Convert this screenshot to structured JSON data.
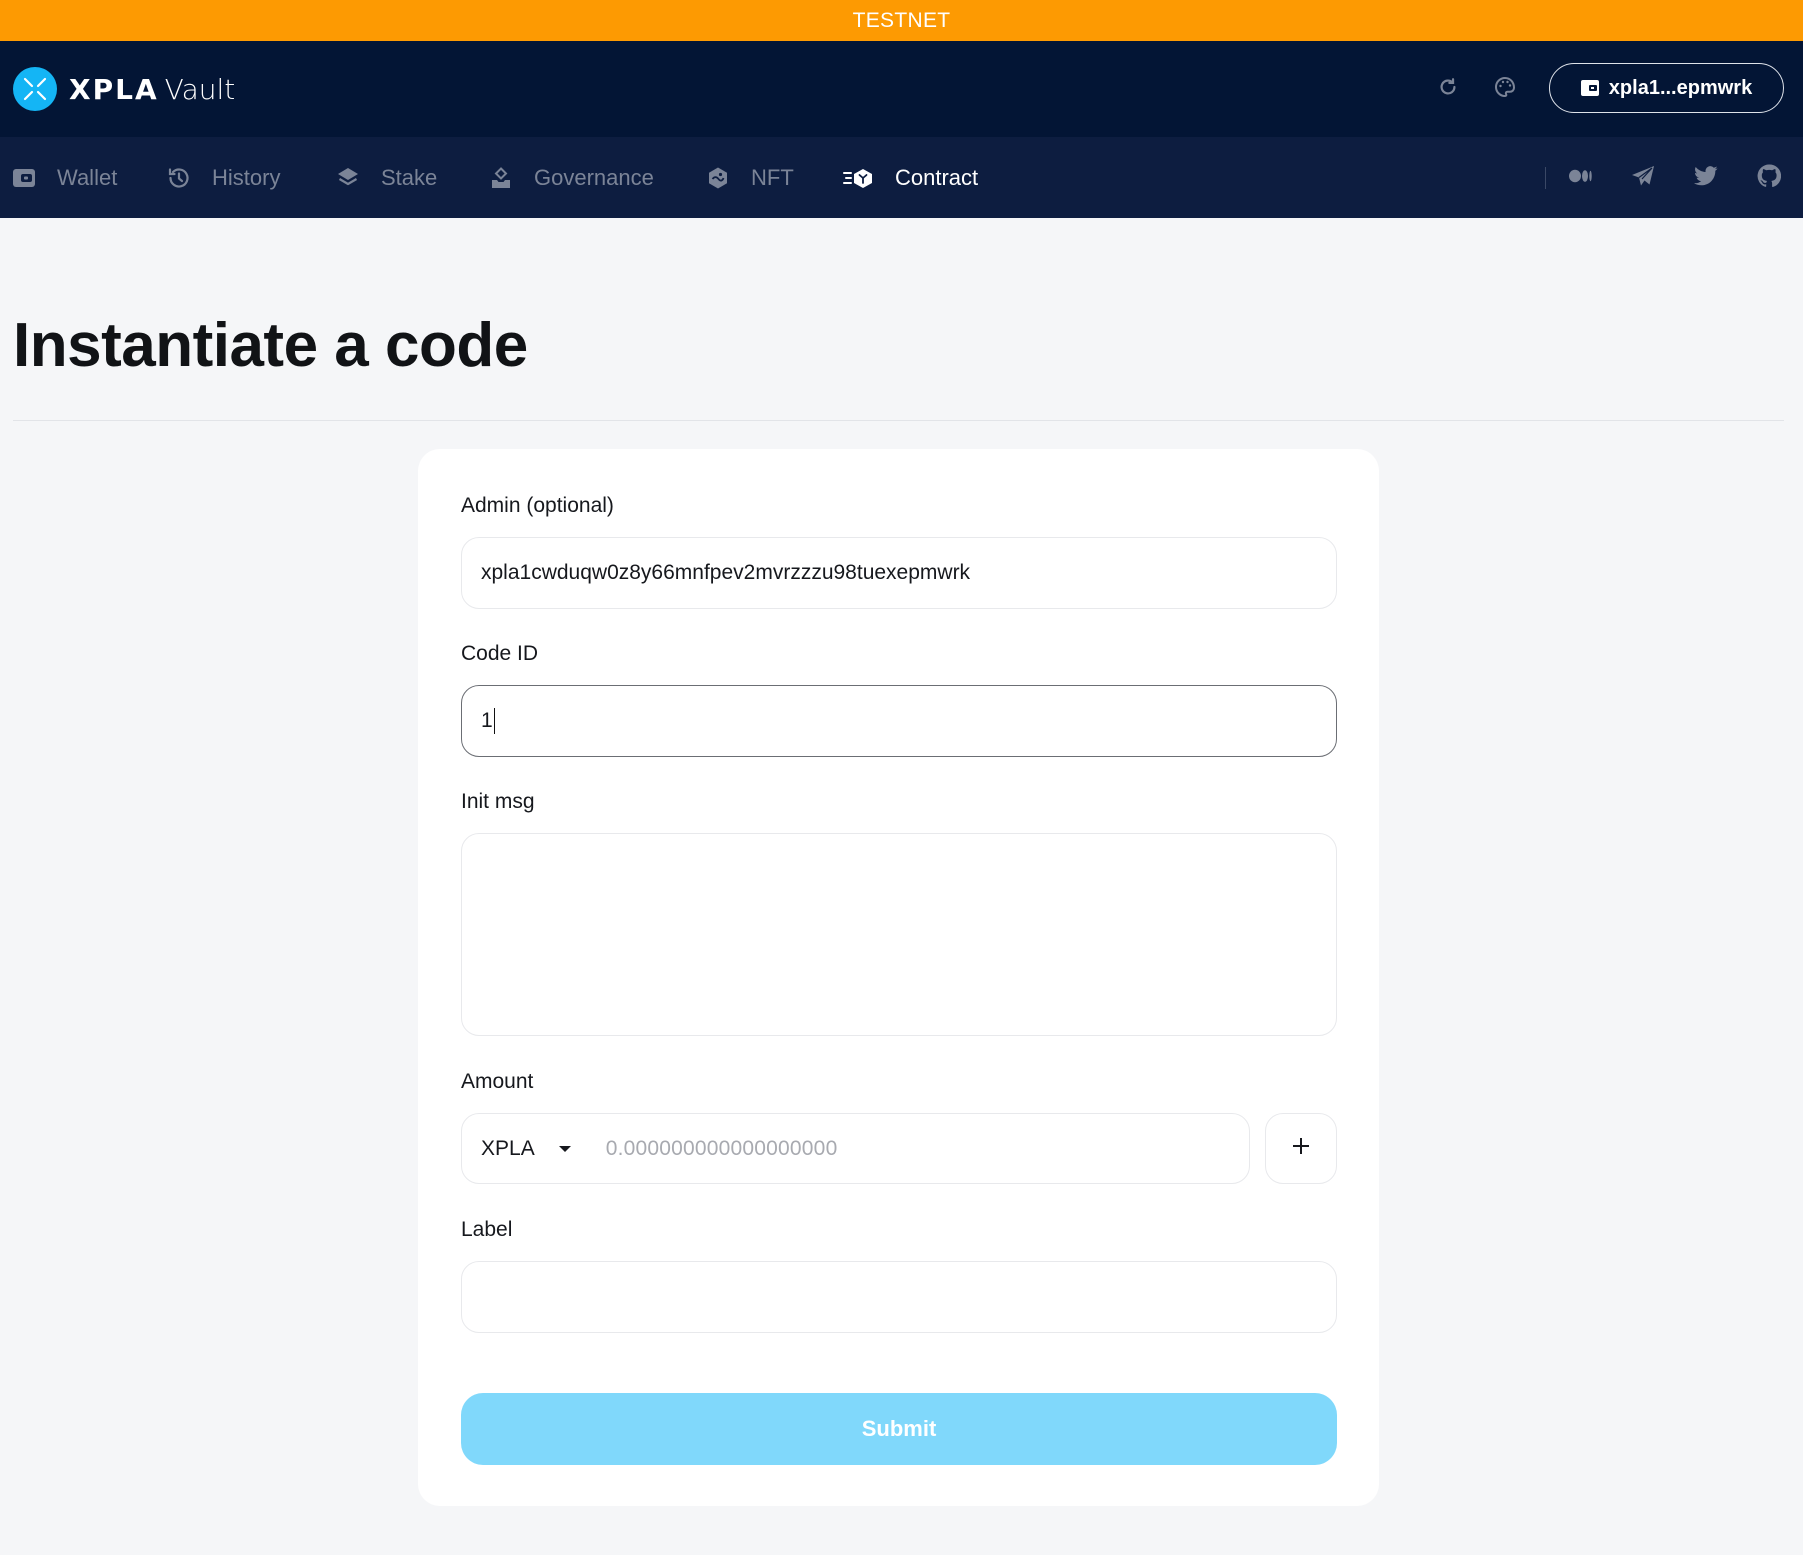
{
  "banner": {
    "label": "TESTNET",
    "color": "#fd9a02"
  },
  "header": {
    "logo": {
      "brand": "XPLA",
      "product": "Vault",
      "icon": "xpla-logo-icon"
    },
    "actions": [
      {
        "name": "refresh",
        "icon": "refresh-icon"
      },
      {
        "name": "theme",
        "icon": "palette-icon"
      }
    ],
    "wallet": {
      "icon": "wallet-icon",
      "address_short": "xpla1...epmwrk"
    }
  },
  "nav": {
    "items": [
      {
        "label": "Wallet",
        "icon": "wallet-icon",
        "active": false
      },
      {
        "label": "History",
        "icon": "history-icon",
        "active": false
      },
      {
        "label": "Stake",
        "icon": "layers-icon",
        "active": false
      },
      {
        "label": "Governance",
        "icon": "ballot-icon",
        "active": false
      },
      {
        "label": "NFT",
        "icon": "nft-icon",
        "active": false
      },
      {
        "label": "Contract",
        "icon": "contract-icon",
        "active": true
      }
    ],
    "social": [
      {
        "name": "medium",
        "icon": "medium-icon"
      },
      {
        "name": "telegram",
        "icon": "telegram-icon"
      },
      {
        "name": "twitter",
        "icon": "twitter-icon"
      },
      {
        "name": "github",
        "icon": "github-icon"
      }
    ]
  },
  "page": {
    "title": "Instantiate a code"
  },
  "form": {
    "admin": {
      "label": "Admin (optional)",
      "value": "xpla1cwduqw0z8y66mnfpev2mvrzzzu98tuexepmwrk"
    },
    "code_id": {
      "label": "Code ID",
      "value": "1"
    },
    "init_msg": {
      "label": "Init msg",
      "value": ""
    },
    "amount": {
      "label": "Amount",
      "denom": "XPLA",
      "placeholder": "0.000000000000000000",
      "add_label": "+"
    },
    "label": {
      "label": "Label",
      "value": ""
    },
    "submit": {
      "label": "Submit",
      "disabled": true,
      "color": "#80d8fb"
    }
  }
}
